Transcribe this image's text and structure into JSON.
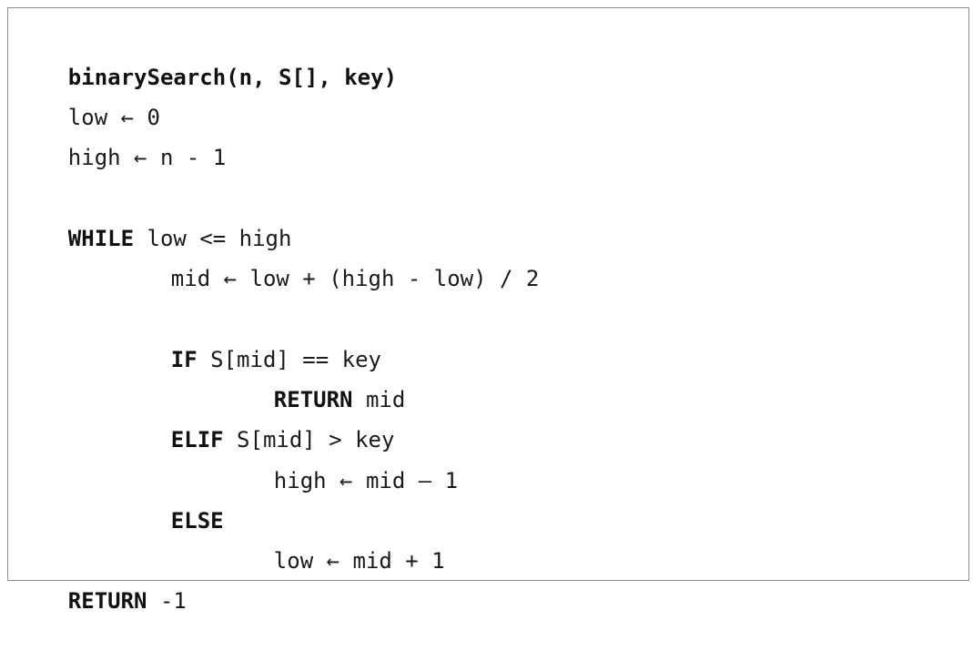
{
  "pseudocode": {
    "signature": "binarySearch(n, S[], key)",
    "line_low_init": "low ← 0",
    "line_high_init": "high ← n - 1",
    "while_keyword": "WHILE",
    "while_condition": " low <= high",
    "line_mid": "mid ← low + (high - low) / 2",
    "if_keyword": "IF",
    "if_condition": " S[mid] == key",
    "return_keyword": "RETURN",
    "return_mid_value": " mid",
    "elif_keyword": "ELIF",
    "elif_condition": " S[mid] > key",
    "line_high_update": "high ← mid – 1",
    "else_keyword": "ELSE",
    "line_low_update": "low ← mid + 1",
    "final_return_keyword": "RETURN",
    "final_return_value": " -1"
  }
}
